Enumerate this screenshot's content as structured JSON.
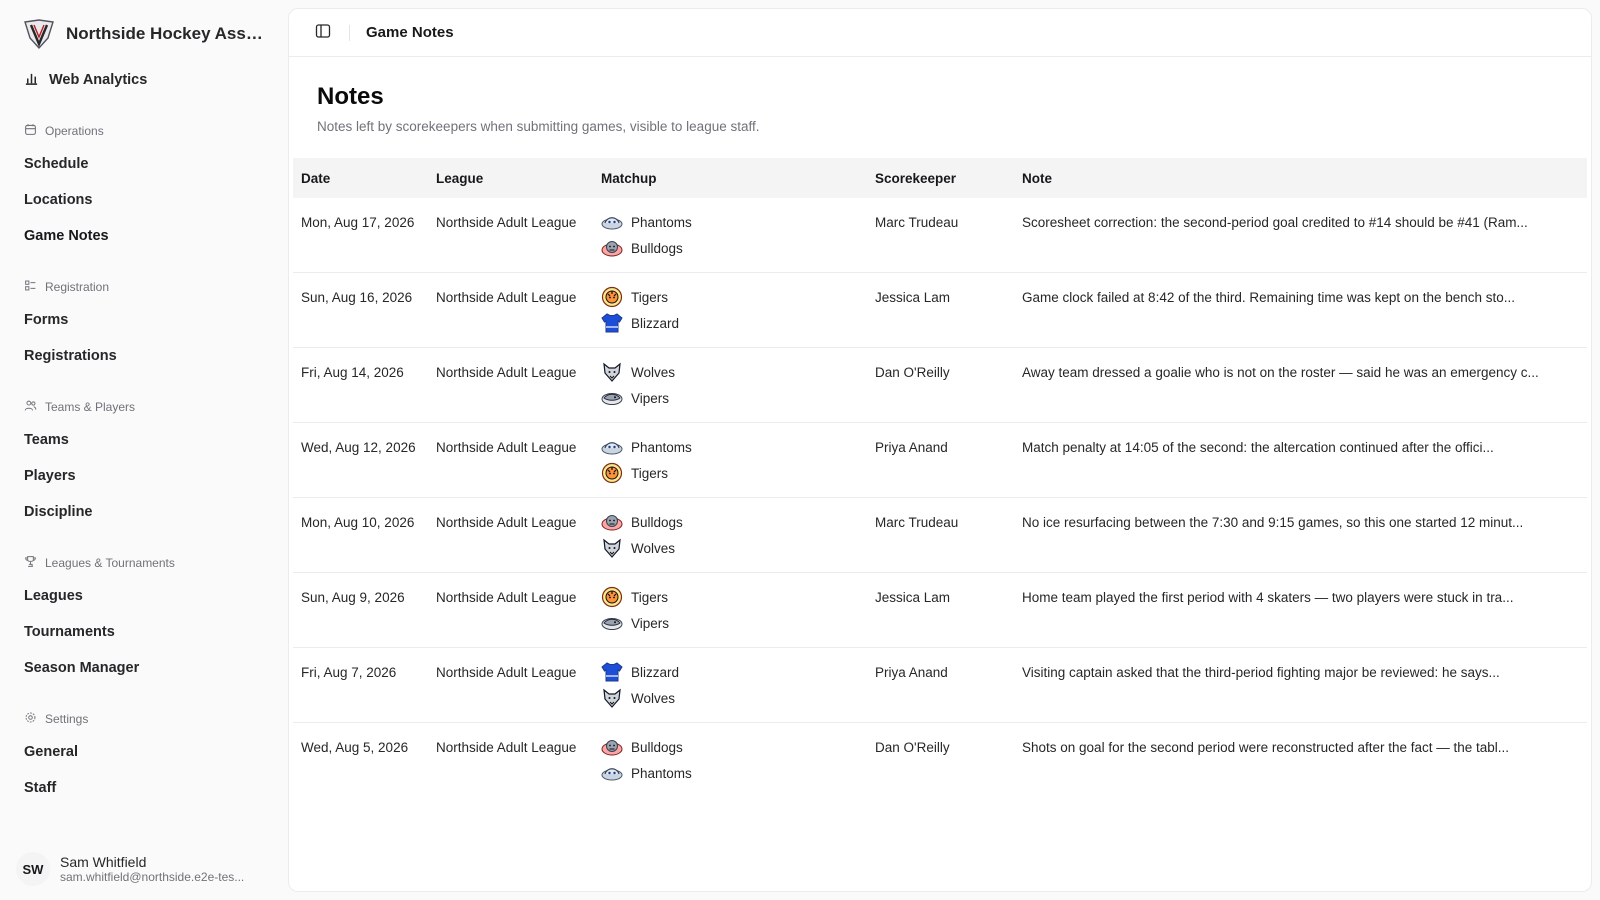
{
  "brand": {
    "name": "Northside Hockey Asso..."
  },
  "top_link": {
    "label": "Web Analytics",
    "icon": "bar-chart-icon"
  },
  "sidebar_groups": [
    {
      "label": "Operations",
      "icon": "calendar-icon",
      "items": [
        "Schedule",
        "Locations",
        "Game Notes"
      ]
    },
    {
      "label": "Registration",
      "icon": "list-icon",
      "items": [
        "Forms",
        "Registrations"
      ]
    },
    {
      "label": "Teams & Players",
      "icon": "users-icon",
      "items": [
        "Teams",
        "Players",
        "Discipline"
      ]
    },
    {
      "label": "Leagues & Tournaments",
      "icon": "trophy-icon",
      "items": [
        "Leagues",
        "Tournaments",
        "Season Manager"
      ]
    },
    {
      "label": "Settings",
      "icon": "gear-icon",
      "items": [
        "General",
        "Staff"
      ]
    }
  ],
  "user": {
    "initials": "SW",
    "name": "Sam Whitfield",
    "email": "sam.whitfield@northside.e2e-tes..."
  },
  "topbar": {
    "breadcrumb": "Game Notes"
  },
  "page": {
    "title": "Notes",
    "subtitle": "Notes left by scorekeepers when submitting games, visible to league staff."
  },
  "table": {
    "columns": [
      "Date",
      "League",
      "Matchup",
      "Scorekeeper",
      "Note"
    ],
    "rows": [
      {
        "date": "Mon, Aug 17, 2026",
        "league": "Northside Adult League",
        "home": "Phantoms",
        "away": "Bulldogs",
        "scorekeeper": "Marc Trudeau",
        "note": "Scoresheet correction: the second-period goal credited to #14 should be #41 (Ram..."
      },
      {
        "date": "Sun, Aug 16, 2026",
        "league": "Northside Adult League",
        "home": "Tigers",
        "away": "Blizzard",
        "scorekeeper": "Jessica Lam",
        "note": "Game clock failed at 8:42 of the third. Remaining time was kept on the bench sto..."
      },
      {
        "date": "Fri, Aug 14, 2026",
        "league": "Northside Adult League",
        "home": "Wolves",
        "away": "Vipers",
        "scorekeeper": "Dan O'Reilly",
        "note": "Away team dressed a goalie who is not on the roster — said he was an emergency c..."
      },
      {
        "date": "Wed, Aug 12, 2026",
        "league": "Northside Adult League",
        "home": "Phantoms",
        "away": "Tigers",
        "scorekeeper": "Priya Anand",
        "note": "Match penalty at 14:05 of the second: the altercation continued after the offici..."
      },
      {
        "date": "Mon, Aug 10, 2026",
        "league": "Northside Adult League",
        "home": "Bulldogs",
        "away": "Wolves",
        "scorekeeper": "Marc Trudeau",
        "note": "No ice resurfacing between the 7:30 and 9:15 games, so this one started 12 minut..."
      },
      {
        "date": "Sun, Aug 9, 2026",
        "league": "Northside Adult League",
        "home": "Tigers",
        "away": "Vipers",
        "scorekeeper": "Jessica Lam",
        "note": "Home team played the first period with 4 skaters — two players were stuck in tra..."
      },
      {
        "date": "Fri, Aug 7, 2026",
        "league": "Northside Adult League",
        "home": "Blizzard",
        "away": "Wolves",
        "scorekeeper": "Priya Anand",
        "note": "Visiting captain asked that the third-period fighting major be reviewed: he says..."
      },
      {
        "date": "Wed, Aug 5, 2026",
        "league": "Northside Adult League",
        "home": "Bulldogs",
        "away": "Phantoms",
        "scorekeeper": "Dan O'Reilly",
        "note": "Shots on goal for the second period were reconstructed after the fact — the tabl..."
      }
    ]
  },
  "team_icons": {
    "Phantoms": "phantoms-logo-icon",
    "Bulldogs": "bulldogs-logo-icon",
    "Tigers": "tigers-logo-icon",
    "Blizzard": "blizzard-jersey-icon",
    "Wolves": "wolves-logo-icon",
    "Vipers": "vipers-logo-icon"
  }
}
